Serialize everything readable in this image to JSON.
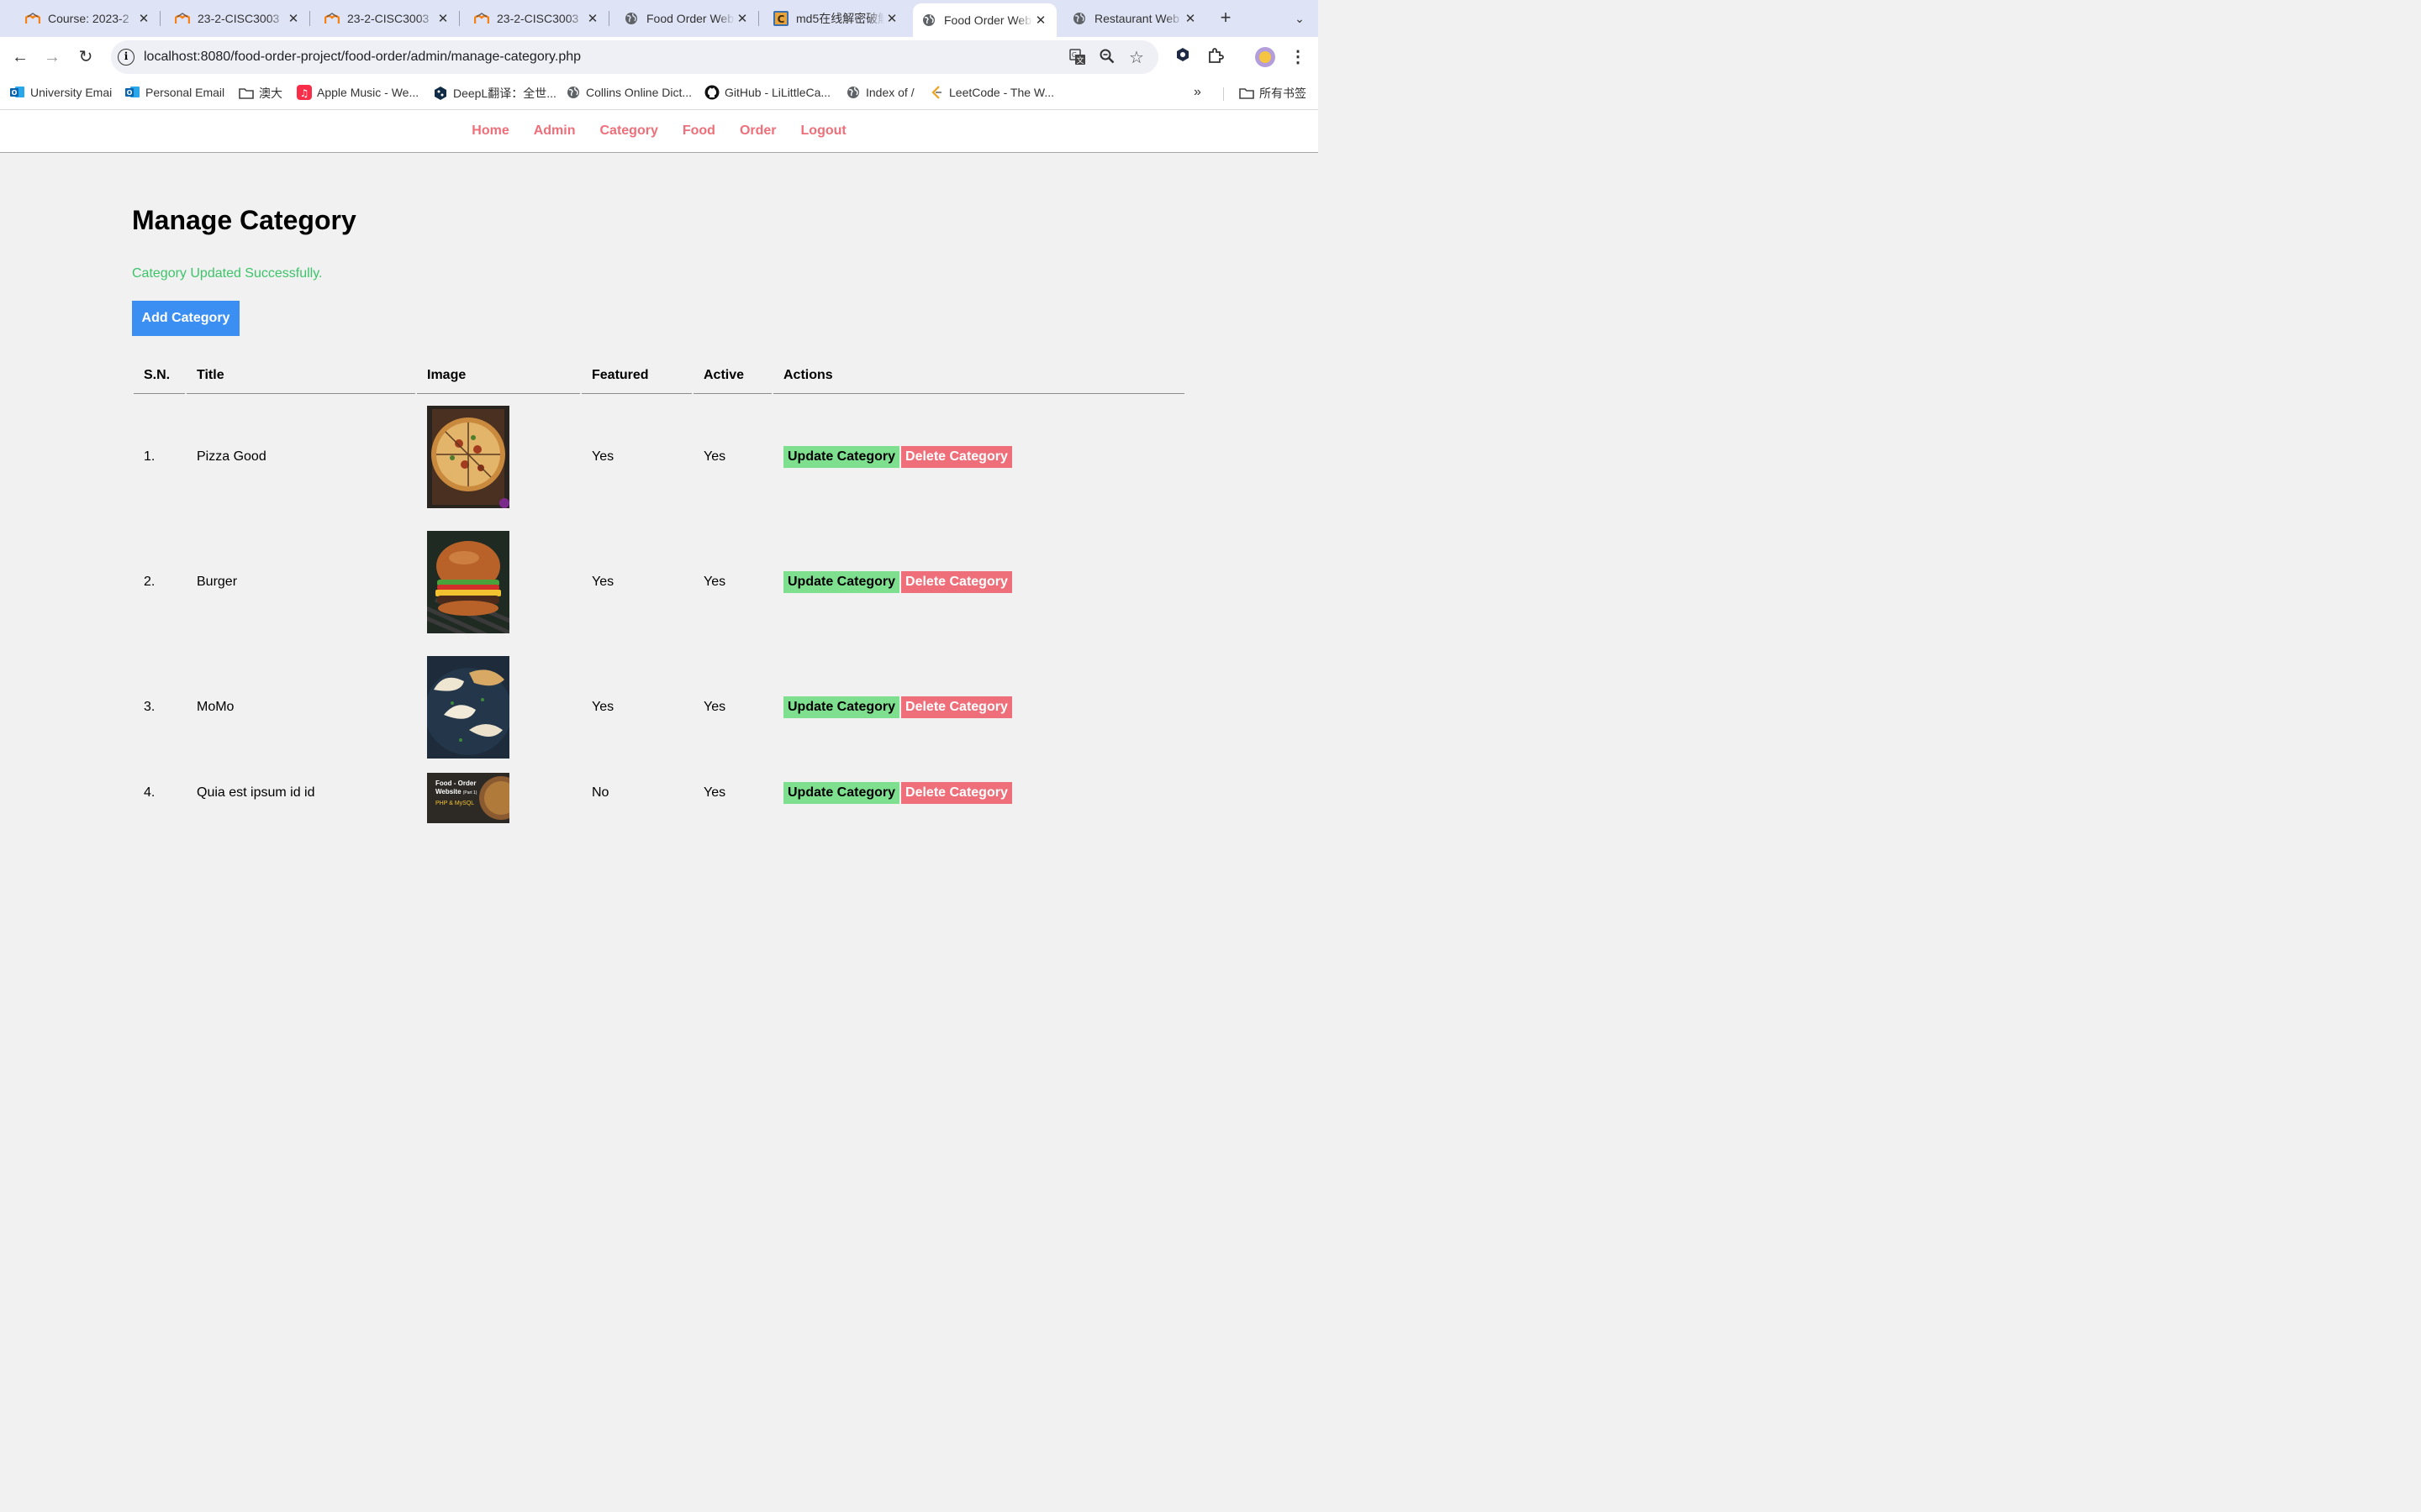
{
  "browser": {
    "tabs": [
      {
        "title": "Course: 2023-2",
        "icon": "moodle-icon"
      },
      {
        "title": "23-2-CISC3003",
        "icon": "moodle-icon"
      },
      {
        "title": "23-2-CISC3003",
        "icon": "moodle-icon"
      },
      {
        "title": "23-2-CISC3003",
        "icon": "moodle-icon"
      },
      {
        "title": "Food Order Web",
        "icon": "globe-icon"
      },
      {
        "title": "md5在线解密破解",
        "icon": "cmd5-icon"
      },
      {
        "title": "Food Order Web",
        "icon": "globe-icon",
        "active": true
      },
      {
        "title": "Restaurant Web",
        "icon": "globe-icon"
      }
    ],
    "url": "localhost:8080/food-order-project/food-order/admin/manage-category.php",
    "bookmarks": [
      {
        "label": "University Emai",
        "icon": "outlook-icon"
      },
      {
        "label": "Personal Email",
        "icon": "outlook-icon"
      },
      {
        "label": "澳大",
        "icon": "folder-icon"
      },
      {
        "label": "Apple Music - We...",
        "icon": "apple-music-icon"
      },
      {
        "label": "DeepL翻译：全世...",
        "icon": "deepl-icon"
      },
      {
        "label": "Collins Online Dict...",
        "icon": "globe-icon"
      },
      {
        "label": "GitHub - LiLittleCa...",
        "icon": "github-icon"
      },
      {
        "label": "Index of /",
        "icon": "globe-icon"
      },
      {
        "label": "LeetCode - The W...",
        "icon": "leetcode-icon"
      }
    ],
    "all_bookmarks": "所有书签"
  },
  "nav": {
    "items": [
      "Home",
      "Admin",
      "Category",
      "Food",
      "Order",
      "Logout"
    ]
  },
  "page": {
    "title": "Manage Category",
    "message": "Category Updated Successfully.",
    "add_button": "Add Category",
    "columns": [
      "S.N.",
      "Title",
      "Image",
      "Featured",
      "Active",
      "Actions"
    ],
    "rows": [
      {
        "sn": "1.",
        "title": "Pizza Good",
        "image": "pizza",
        "featured": "Yes",
        "active": "Yes"
      },
      {
        "sn": "2.",
        "title": "Burger",
        "image": "burger",
        "featured": "Yes",
        "active": "Yes"
      },
      {
        "sn": "3.",
        "title": "MoMo",
        "image": "momo",
        "featured": "Yes",
        "active": "Yes"
      },
      {
        "sn": "4.",
        "title": "Quia est ipsum id id",
        "image": "banner",
        "featured": "No",
        "active": "Yes"
      }
    ],
    "update_label": "Update Category",
    "delete_label": "Delete Category",
    "thumb4_text": {
      "line1": "Food - Order",
      "line2": "Website",
      "part": "(Part 1)",
      "line3": "PHP & MySQL"
    }
  },
  "colors": {
    "link": "#ee6f79",
    "success": "#3cc468",
    "primary": "#3c8ff2",
    "update": "#7ee08f",
    "delete": "#ee6f79"
  }
}
